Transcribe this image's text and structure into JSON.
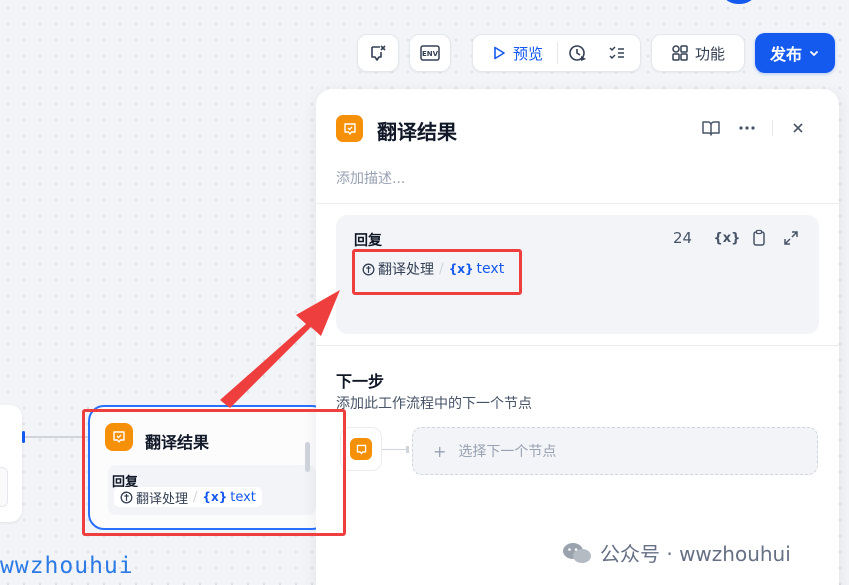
{
  "toolbar": {
    "preview_label": "预览",
    "features_label": "功能",
    "publish_label": "发布"
  },
  "canvas_node": {
    "title": "翻译结果",
    "body_label": "回复",
    "var_source": "翻译处理",
    "var_name": "text"
  },
  "panel": {
    "title": "翻译结果",
    "description_placeholder": "添加描述...",
    "reply": {
      "label": "回复",
      "char_count": "24",
      "var_source": "翻译处理",
      "var_name": "text"
    },
    "next_step": {
      "title": "下一步",
      "description": "添加此工作流程中的下一个节点",
      "select_label": "选择下一个节点"
    }
  },
  "colors": {
    "accent": "#155aef",
    "node_icon": "#f79009",
    "annotation": "#ef3e3e"
  },
  "watermarks": {
    "left": "wwzhouhui",
    "right": "公众号 · wwzhouhui"
  }
}
